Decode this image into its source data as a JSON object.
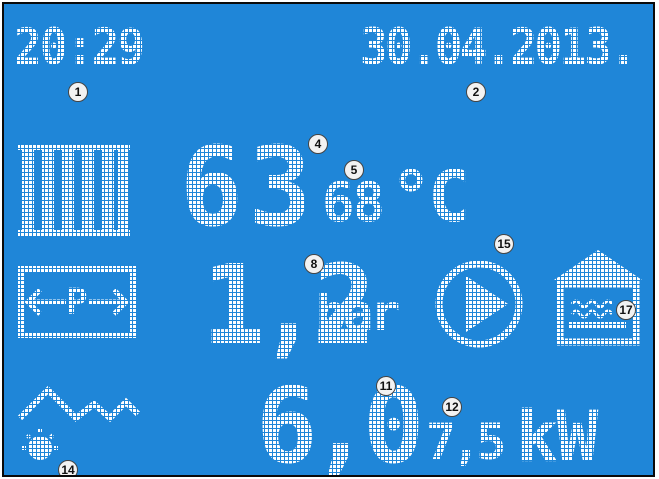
{
  "status_bar": {
    "time": "20:29",
    "date": "30.04.2013."
  },
  "boiler": {
    "current_temp": "63",
    "set_temp": "68",
    "temp_unit": "°C"
  },
  "pressure": {
    "value": "1,2",
    "unit": "bar",
    "icon_label": "P"
  },
  "outdoor": {
    "value": "6,0"
  },
  "power": {
    "value": "7,5",
    "unit": "kW"
  },
  "callouts": {
    "c1": "1",
    "c2": "2",
    "c4": "4",
    "c5": "5",
    "c8": "8",
    "c11": "11",
    "c12": "12",
    "c14": "14",
    "c15": "15",
    "c17": "17"
  },
  "icons": {
    "radiator": "radiator-icon",
    "pressure_gauge": "pressure-icon",
    "pump": "circulation-pump-icon",
    "house": "house-heating-icon",
    "weather": "outdoor-weather-icon"
  },
  "colors": {
    "background": "#1f86d8",
    "foreground": "#ffffff",
    "frame": "#0a0a0a"
  }
}
